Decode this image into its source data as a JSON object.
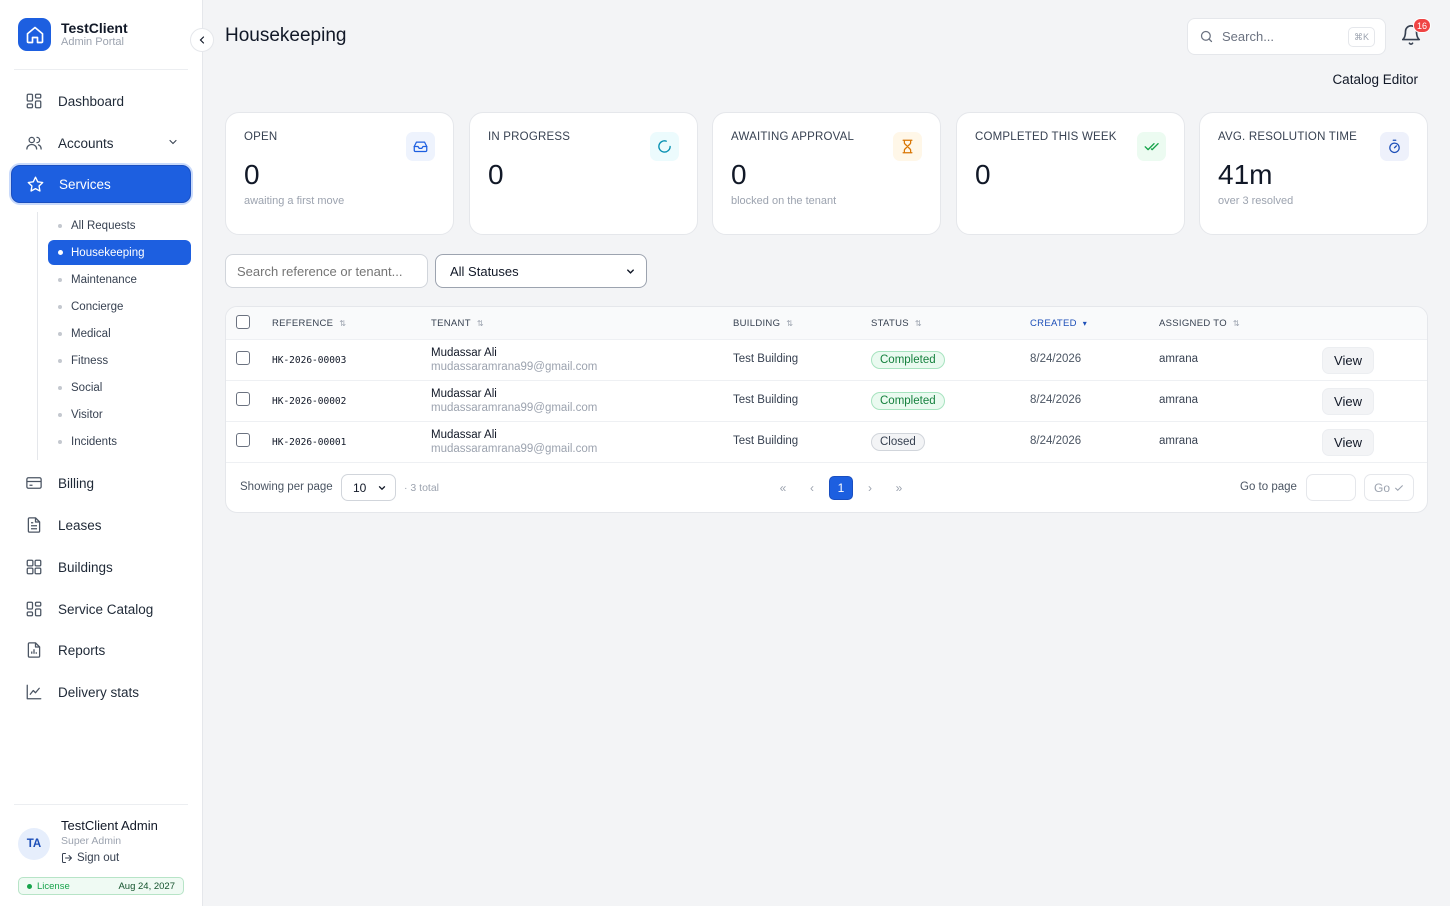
{
  "brand": {
    "name": "TestClient",
    "subtitle": "Admin Portal"
  },
  "sidebar": {
    "items": [
      {
        "label": "Dashboard",
        "icon": "dashboard-grid-icon"
      },
      {
        "label": "Accounts",
        "icon": "users-icon",
        "expandable": true
      },
      {
        "label": "Services",
        "icon": "star-icon",
        "active": true
      },
      {
        "label": "Billing",
        "icon": "credit-card-icon"
      },
      {
        "label": "Leases",
        "icon": "document-icon"
      },
      {
        "label": "Buildings",
        "icon": "grid-icon"
      },
      {
        "label": "Service Catalog",
        "icon": "grid-icon"
      },
      {
        "label": "Reports",
        "icon": "report-icon"
      },
      {
        "label": "Delivery stats",
        "icon": "line-chart-icon"
      }
    ],
    "services_sub": [
      {
        "label": "All Requests"
      },
      {
        "label": "Housekeeping",
        "active": true
      },
      {
        "label": "Maintenance"
      },
      {
        "label": "Concierge"
      },
      {
        "label": "Medical"
      },
      {
        "label": "Fitness"
      },
      {
        "label": "Social"
      },
      {
        "label": "Visitor"
      },
      {
        "label": "Incidents"
      }
    ]
  },
  "user": {
    "initials": "TA",
    "name": "TestClient Admin",
    "role": "Super Admin",
    "signout": "Sign out",
    "license_label": "License",
    "license_date": "Aug 24, 2027"
  },
  "header": {
    "title": "Housekeeping",
    "search_placeholder": "Search...",
    "search_shortcut": "⌘K",
    "notifications_count": "16",
    "catalog_editor": "Catalog Editor"
  },
  "stats": [
    {
      "label": "OPEN",
      "value": "0",
      "sub": "awaiting a first move",
      "icon": "inbox-icon",
      "accent": "#1d5fe0",
      "bg": "#eef3fd"
    },
    {
      "label": "IN PROGRESS",
      "value": "0",
      "sub": "",
      "icon": "spinner-icon",
      "accent": "#0891b2",
      "bg": "#ecfbfd"
    },
    {
      "label": "AWAITING APPROVAL",
      "value": "0",
      "sub": "blocked on the tenant",
      "icon": "hourglass-icon",
      "accent": "#d97706",
      "bg": "#fff7e8"
    },
    {
      "label": "COMPLETED THIS WEEK",
      "value": "0",
      "sub": "",
      "icon": "double-check-icon",
      "accent": "#16a34a",
      "bg": "#ecfbf1"
    },
    {
      "label": "AVG. RESOLUTION TIME",
      "value": "41m",
      "sub": "over 3 resolved",
      "icon": "stopwatch-icon",
      "accent": "#1d4fb8",
      "bg": "#eef1fb"
    }
  ],
  "filters": {
    "search_placeholder": "Search reference or tenant...",
    "status_selected": "All Statuses"
  },
  "table": {
    "columns": [
      "REFERENCE",
      "TENANT",
      "BUILDING",
      "STATUS",
      "CREATED",
      "ASSIGNED TO"
    ],
    "sorted_column": "CREATED",
    "rows": [
      {
        "reference": "HK-2026-00003",
        "tenant_name": "Mudassar Ali",
        "tenant_email": "mudassaramrana99@gmail.com",
        "building": "Test Building",
        "status": "Completed",
        "created": "8/24/2026",
        "assigned": "amrana",
        "action": "View"
      },
      {
        "reference": "HK-2026-00002",
        "tenant_name": "Mudassar Ali",
        "tenant_email": "mudassaramrana99@gmail.com",
        "building": "Test Building",
        "status": "Completed",
        "created": "8/24/2026",
        "assigned": "amrana",
        "action": "View"
      },
      {
        "reference": "HK-2026-00001",
        "tenant_name": "Mudassar Ali",
        "tenant_email": "mudassaramrana99@gmail.com",
        "building": "Test Building",
        "status": "Closed",
        "created": "8/24/2026",
        "assigned": "amrana",
        "action": "View"
      }
    ]
  },
  "pagination": {
    "per_page_label": "Showing per page",
    "per_page": "10",
    "total": "· 3 total",
    "current_page": "1",
    "first": "«",
    "prev": "‹",
    "next": "›",
    "last": "»",
    "goto_label": "Go to page",
    "go": "Go"
  }
}
